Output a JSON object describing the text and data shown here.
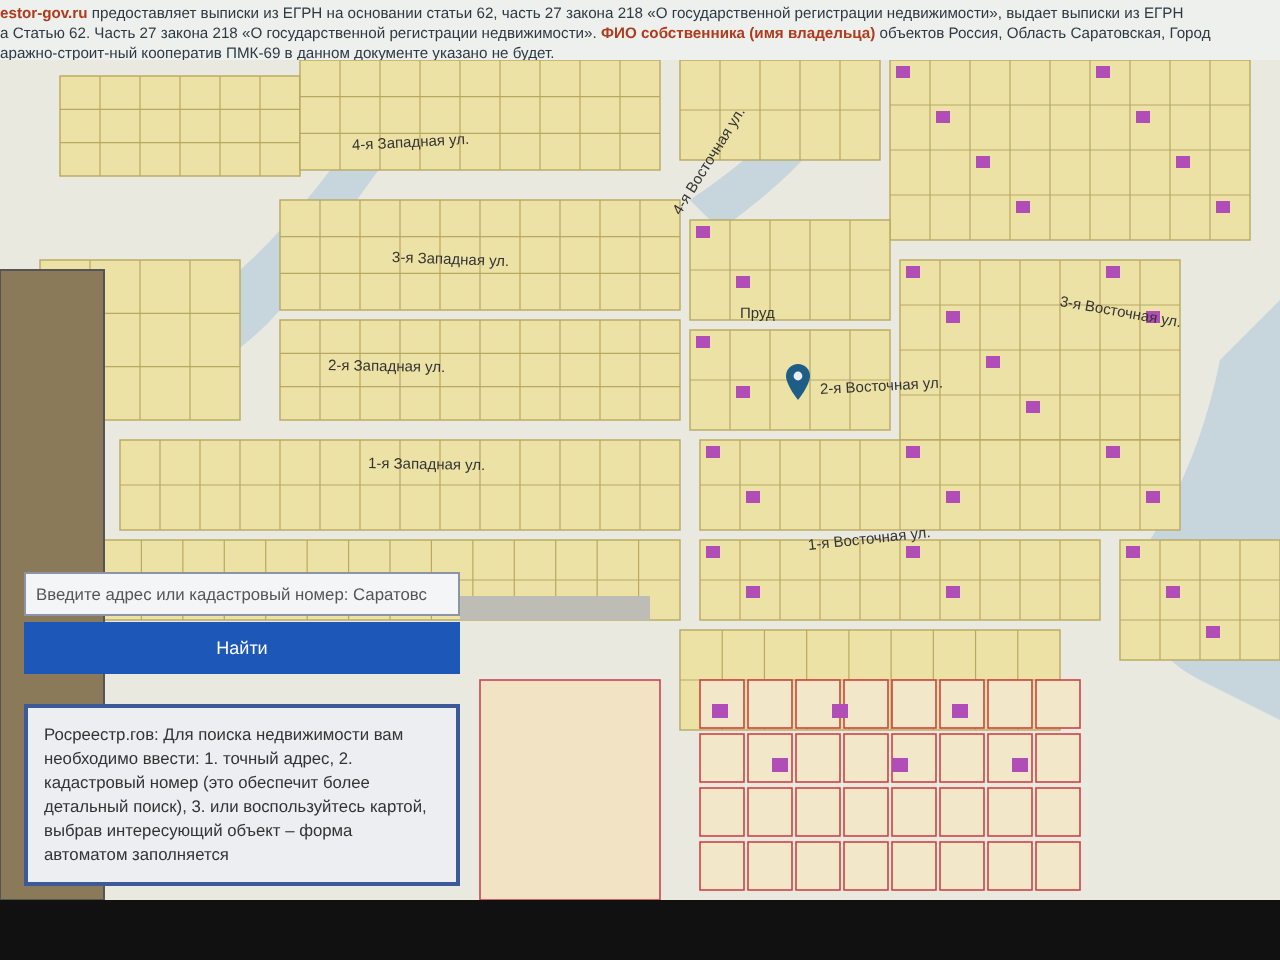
{
  "notice": {
    "lines": [
      "**estor-gov.ru** предоставляет выписки из ЕГРН на основании статьи 62, часть 27 закона 218 «О государственной регистрации недвижимости», выдает выписки из ЕГРН",
      "а Статью 62. Часть 27 закона 218 «О государственной регистрации недвижимости». **ФИО собственника (имя владельца)** объектов Россия, Область Саратовская, Город",
      "аражно-строит-ный кооператив ПМК-69 в данном документе указано не будет."
    ]
  },
  "map": {
    "labels": [
      "4-я Западная ул.",
      "4-я Восточная ул.",
      "3-я Западная ул.",
      "3-я Восточная ул.",
      "2-я Западная ул.",
      "2-я Восточная ул.",
      "1-я Западная ул.",
      "1-я Восточная ул.",
      "Пруд"
    ]
  },
  "search": {
    "placeholder": "Введите адрес или кадастровый номер: Саратовс",
    "button": "Найти"
  },
  "info": {
    "text": "Росреестр.гов: Для поиска недвижимости вам необходимо ввести: 1. точный адрес, 2. кадастровый номер (это обеспечит более детальный поиск), 3. или воспользуйтесь картой, выбрав интересующий объект – форма автоматом заполняется"
  }
}
